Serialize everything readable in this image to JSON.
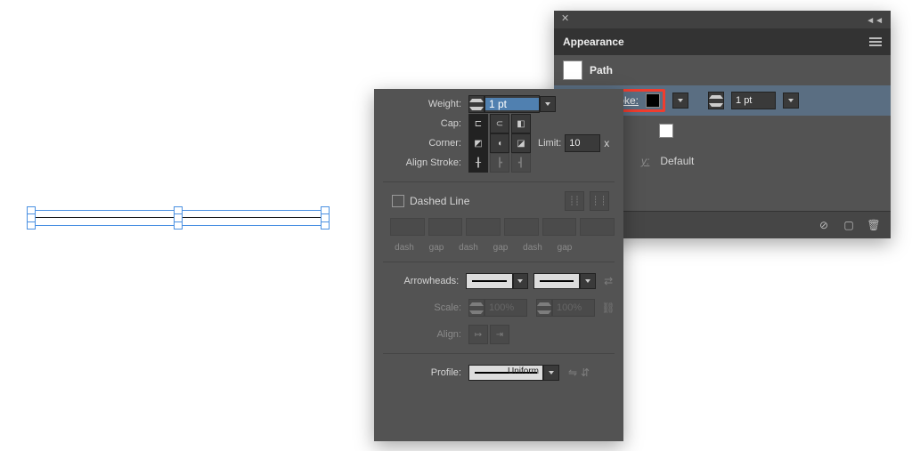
{
  "canvas": {
    "type": "path-line"
  },
  "appearance": {
    "tab": "Appearance",
    "path_label": "Path",
    "stroke_label": "Stroke:",
    "stroke_weight": "1 pt",
    "opacity_label": "Opacity:",
    "opacity_value": "Default"
  },
  "stroke": {
    "weight_label": "Weight:",
    "weight_value": "1 pt",
    "cap_label": "Cap:",
    "corner_label": "Corner:",
    "limit_label": "Limit:",
    "limit_value": "10",
    "limit_unit": "x",
    "align_label": "Align Stroke:",
    "dashed_label": "Dashed Line",
    "dash_headers": [
      "dash",
      "gap",
      "dash",
      "gap",
      "dash",
      "gap"
    ],
    "arrowheads_label": "Arrowheads:",
    "scale_label": "Scale:",
    "scale_value": "100%",
    "arrow_align_label": "Align:",
    "profile_label": "Profile:",
    "profile_value": "Uniform"
  }
}
